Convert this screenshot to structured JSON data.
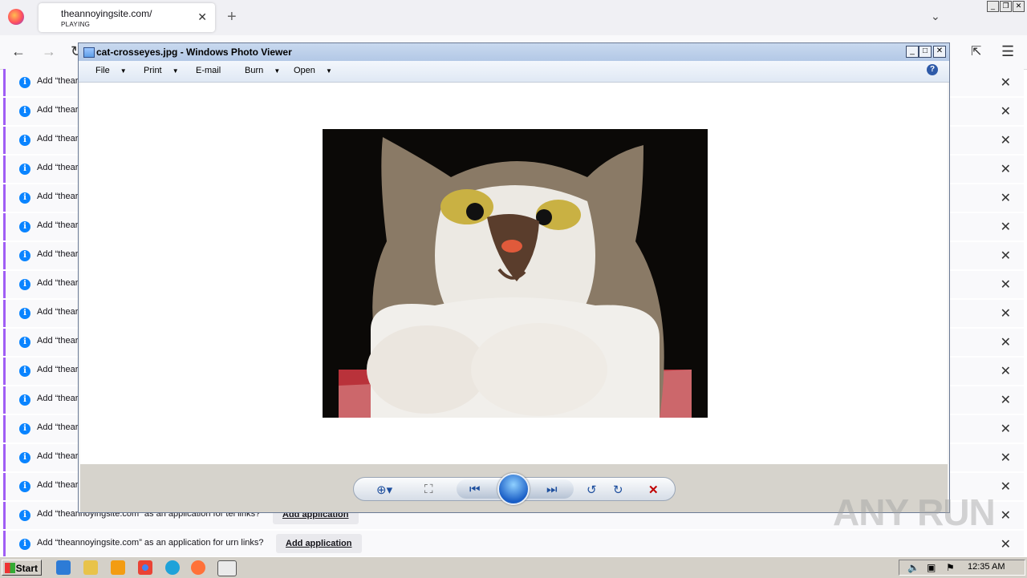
{
  "browser": {
    "tab_title": "theannoyingsite.com/",
    "tab_status": "PLAYING",
    "new_tab": "+"
  },
  "notifications": [
    {
      "text": "Add “theannoyingsite.com” as an application for mailto links?",
      "visible_text": "Add “thear"
    },
    {
      "text": "Add “thear",
      "visible_text": "Add “thear"
    },
    {
      "text": "Add “thear",
      "visible_text": "Add “thear"
    },
    {
      "text": "Add “thear",
      "visible_text": "Add “thear"
    },
    {
      "text": "Add “thear",
      "visible_text": "Add “thear"
    },
    {
      "text": "Add “thear",
      "visible_text": "Add “thear"
    },
    {
      "text": "Add “thear",
      "visible_text": "Add “thear"
    },
    {
      "text": "Add “thear",
      "visible_text": "Add “thear"
    },
    {
      "text": "Add “thear",
      "visible_text": "Add “thear"
    },
    {
      "text": "Add “thear",
      "visible_text": "Add “thear"
    },
    {
      "text": "Add “thear",
      "visible_text": "Add “thear"
    },
    {
      "text": "Add “thear",
      "visible_text": "Add “thear"
    },
    {
      "text": "Add “thear",
      "visible_text": "Add “thear"
    },
    {
      "text": "Add “thear",
      "visible_text": "Add “thear"
    },
    {
      "text": "Add “thear",
      "visible_text": "Add “thear"
    },
    {
      "text": "Add “theannoyingsite.com” as an application for tel links?",
      "visible_text": "Add “theannoyingsite.com” as an application for tel links?"
    },
    {
      "text": "Add “theannoyingsite.com” as an application for urn links?",
      "visible_text": "Add “theannoyingsite.com” as an application for urn links?"
    }
  ],
  "add_application_label": "Add application",
  "photo_viewer": {
    "title": "cat-crosseyes.jpg - Windows Photo Viewer",
    "menu": [
      "File",
      "Print",
      "E-mail",
      "Burn",
      "Open"
    ],
    "help": "?"
  },
  "taskbar": {
    "start_label": "Start",
    "clock": "12:35 AM"
  },
  "watermark": "ANY RUN",
  "colors": {
    "info_icon": "#0a84ff",
    "notif_accent": "#a05ef5",
    "delete_icon": "#c00000"
  }
}
